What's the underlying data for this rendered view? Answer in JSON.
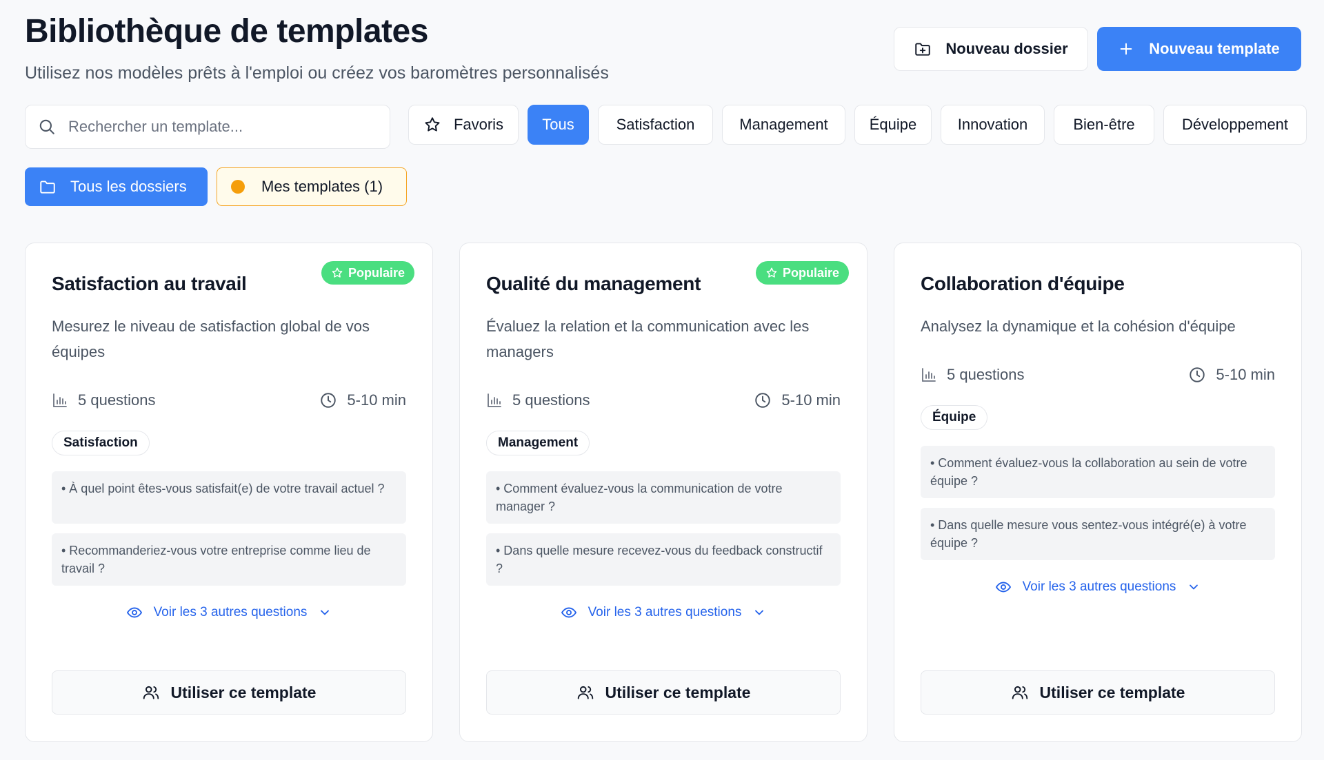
{
  "header": {
    "title": "Bibliothèque de templates",
    "subtitle": "Utilisez nos modèles prêts à l'emploi ou créez vos baromètres personnalisés",
    "new_folder_label": "Nouveau dossier",
    "new_template_label": "Nouveau template"
  },
  "search": {
    "placeholder": "Rechercher un template..."
  },
  "filters": {
    "favorites": "Favoris",
    "categories": [
      "Tous",
      "Satisfaction",
      "Management",
      "Équipe",
      "Innovation",
      "Bien-être",
      "Développement"
    ],
    "active": "Tous"
  },
  "folders": {
    "all_label": "Tous les dossiers",
    "mine_label": "Mes templates (1)"
  },
  "colors": {
    "accent": "#3b82f6",
    "popular": "#4ade80",
    "mine_dot": "#f59e0b",
    "link": "#2563eb"
  },
  "cards": [
    {
      "badge": "Populaire",
      "title": "Satisfaction au travail",
      "description": "Mesurez le niveau de satisfaction global de vos équipes",
      "questions": "5 questions",
      "duration": "5-10 min",
      "tag": "Satisfaction",
      "preview": [
        "• À quel point êtes-vous satisfait(e) de votre travail actuel ?",
        "• Recommanderiez-vous votre entreprise comme lieu de travail ?"
      ],
      "more": "Voir les 3 autres questions",
      "use": "Utiliser ce template"
    },
    {
      "badge": "Populaire",
      "title": "Qualité du management",
      "description": "Évaluez la relation et la communication avec les managers",
      "questions": "5 questions",
      "duration": "5-10 min",
      "tag": "Management",
      "preview": [
        "• Comment évaluez-vous la communication de votre manager ?",
        "• Dans quelle mesure recevez-vous du feedback constructif ?"
      ],
      "more": "Voir les 3 autres questions",
      "use": "Utiliser ce template"
    },
    {
      "badge": "",
      "title": "Collaboration d'équipe",
      "description": "Analysez la dynamique et la cohésion d'équipe",
      "questions": "5 questions",
      "duration": "5-10 min",
      "tag": "Équipe",
      "preview": [
        "• Comment évaluez-vous la collaboration au sein de votre équipe ?",
        "• Dans quelle mesure vous sentez-vous intégré(e) à votre équipe ?"
      ],
      "more": "Voir les 3 autres questions",
      "use": "Utiliser ce template"
    }
  ]
}
